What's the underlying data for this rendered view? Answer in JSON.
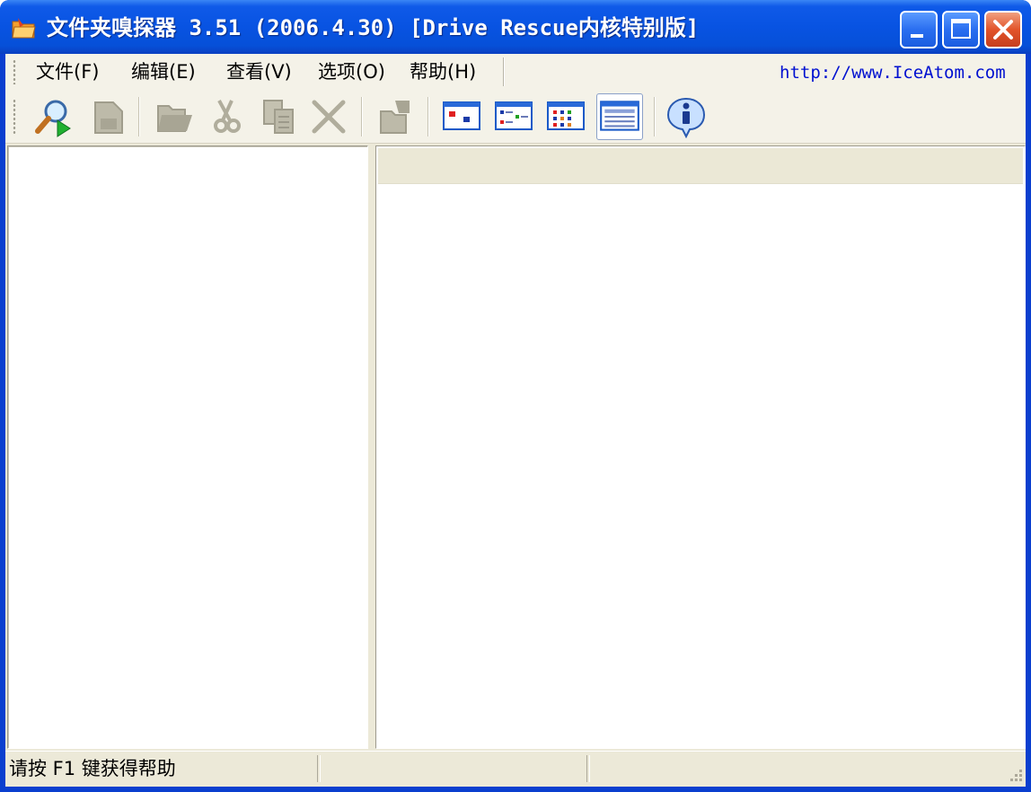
{
  "window": {
    "title": "文件夹嗅探器 3.51 (2006.4.30) [Drive Rescue内核特别版]",
    "controls": {
      "minimize": "minimize-icon",
      "maximize": "maximize-icon",
      "close": "close-icon"
    }
  },
  "menubar": {
    "items": [
      {
        "label": "文件(F)"
      },
      {
        "label": "编辑(E)"
      },
      {
        "label": "查看(V)"
      },
      {
        "label": "选项(O)"
      },
      {
        "label": "帮助(H)"
      }
    ],
    "url": "http://www.IceAtom.com"
  },
  "toolbar": {
    "buttons": [
      {
        "icon": "search-scan-icon",
        "enabled": true
      },
      {
        "icon": "save-icon",
        "enabled": false
      },
      {
        "icon": "open-folder-icon",
        "enabled": false
      },
      {
        "icon": "cut-icon",
        "enabled": false
      },
      {
        "icon": "copy-icon",
        "enabled": false
      },
      {
        "icon": "delete-icon",
        "enabled": false
      },
      {
        "icon": "properties-icon",
        "enabled": false
      },
      {
        "icon": "view-large-icons-icon",
        "enabled": true
      },
      {
        "icon": "view-small-icons-icon",
        "enabled": true
      },
      {
        "icon": "view-list-icon",
        "enabled": true
      },
      {
        "icon": "view-details-icon",
        "enabled": true,
        "pressed": true
      },
      {
        "icon": "about-info-icon",
        "enabled": true
      }
    ]
  },
  "statusbar": {
    "text": "请按 F1 键获得帮助",
    "panel2": "",
    "panel3": ""
  },
  "colors": {
    "titlebar": "#0853e2",
    "url": "#0010d0",
    "face": "#ece9d8"
  }
}
